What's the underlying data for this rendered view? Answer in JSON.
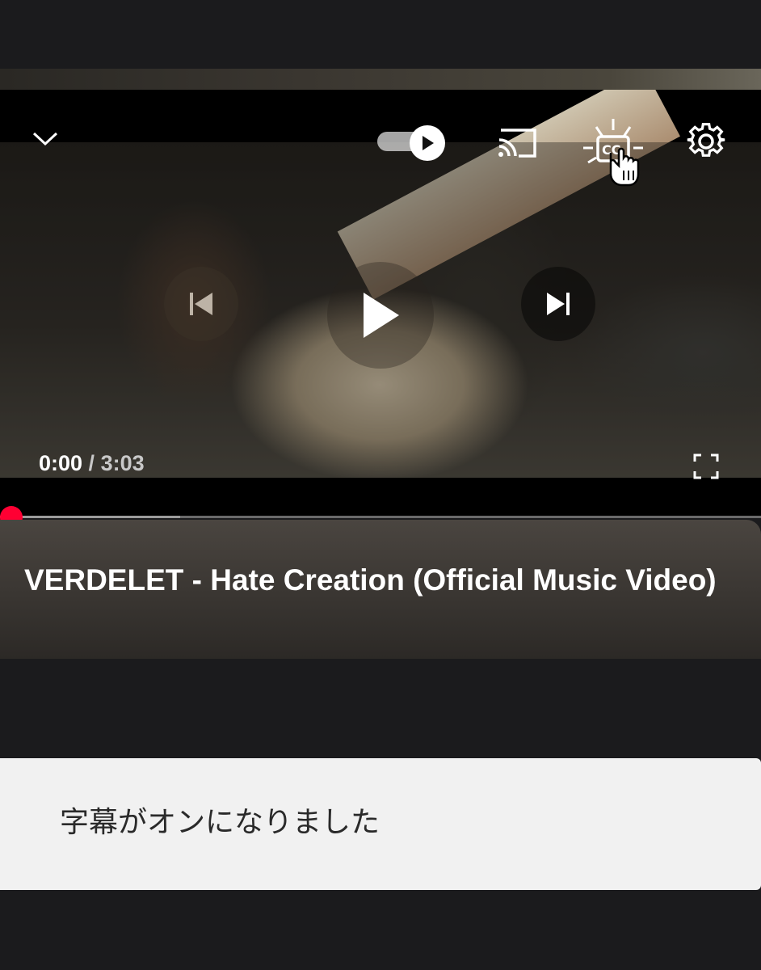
{
  "player": {
    "current_time": "0:00",
    "separator": " / ",
    "duration": "3:03",
    "progress_fraction": 0.0,
    "buffered_fraction": 0.237,
    "accent_color": "#ff0033",
    "autoplay_on": true,
    "captions_button_highlighted": true,
    "icons": {
      "collapse": "chevron-down-icon",
      "autoplay": "autoplay-toggle-icon",
      "cast": "cast-icon",
      "captions": "closed-captions-icon",
      "settings": "gear-icon",
      "previous": "skip-previous-icon",
      "play": "play-icon",
      "next": "skip-next-icon",
      "fullscreen": "fullscreen-icon"
    }
  },
  "video": {
    "title": "VERDELET - Hate Creation (Official Music Video)"
  },
  "toast": {
    "message": "字幕がオンになりました"
  }
}
